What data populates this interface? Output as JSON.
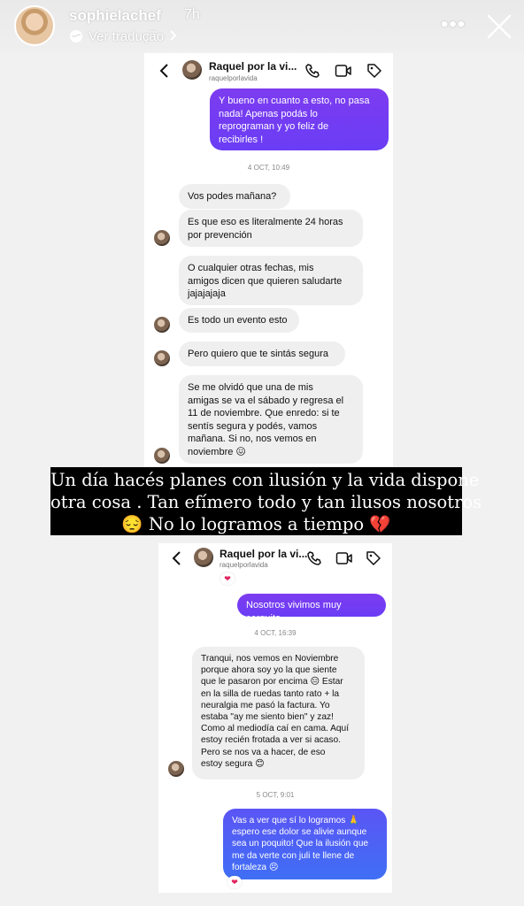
{
  "story": {
    "username": "sophielachef",
    "time": "7h",
    "translate_label": "Ver tradução",
    "more_label": "•••"
  },
  "chat_top": {
    "name": "Raquel por la vi...",
    "handle": "raquelporlavida",
    "outgoing_first": "Y bueno en cuanto a esto, no pasa\nnada! Apenas podás lo\nreprograman y yo feliz de\nrecibirles !",
    "timestamp": "4 OCT, 10:49",
    "messages": [
      "Vos podes mañana?",
      "Es que eso es literalmente 24 horas\npor prevención",
      "O cualquier otras fechas, mis\namigos dicen que quieren saludarte\njajajajaja",
      "Es todo un evento esto",
      "Pero quiero que te sintás segura",
      "Se me olvidó que una de mis\namigas se va el sábado y regresa el\n11 de noviembre. Que enredo: si te\nsentís segura y podés, vamos\nmañana. Si no, nos vemos en\nnoviembre 😖"
    ]
  },
  "caption": {
    "line1": "Un día hacés planes con ilusión y la vida dispone",
    "line2": "otra cosa . Tan efímero todo y tan ilusos nosotros",
    "line3": "😔 No lo logramos a tiempo 💔"
  },
  "chat_bottom": {
    "name": "Raquel por la vi...",
    "handle": "raquelporlavida",
    "heart": "❤",
    "outgoing_1": "Nosotros vivimos muy cerquita",
    "timestamp_1": "4 OCT, 16:39",
    "incoming_1": "Tranqui, nos vemos en Noviembre\nporque ahora soy yo la que siente\nque le pasaron por encima 😑 Estar\nen la silla de ruedas tanto rato + la\nneuralgia me pasó la factura. Yo\nestaba \"ay me siento bien\" y zaz!\nComo al mediodía caí en cama. Aquí\nestoy recién frotada a ver si acaso.\nPero se nos va a hacer, de eso\nestoy segura 😊",
    "timestamp_2": "5 OCT, 9:01",
    "outgoing_2": "Vas a ver que sí lo logramos 🙏\nespero ese dolor se alivie aunque\nsea un poquito! Que la ilusión que\nme da verte con juli te llene de\nfortaleza 😣"
  },
  "colors": {
    "purple_bubble": "#7d3cf0",
    "blue_bubble": "#4f63f5",
    "incoming_bubble": "#efefef"
  }
}
